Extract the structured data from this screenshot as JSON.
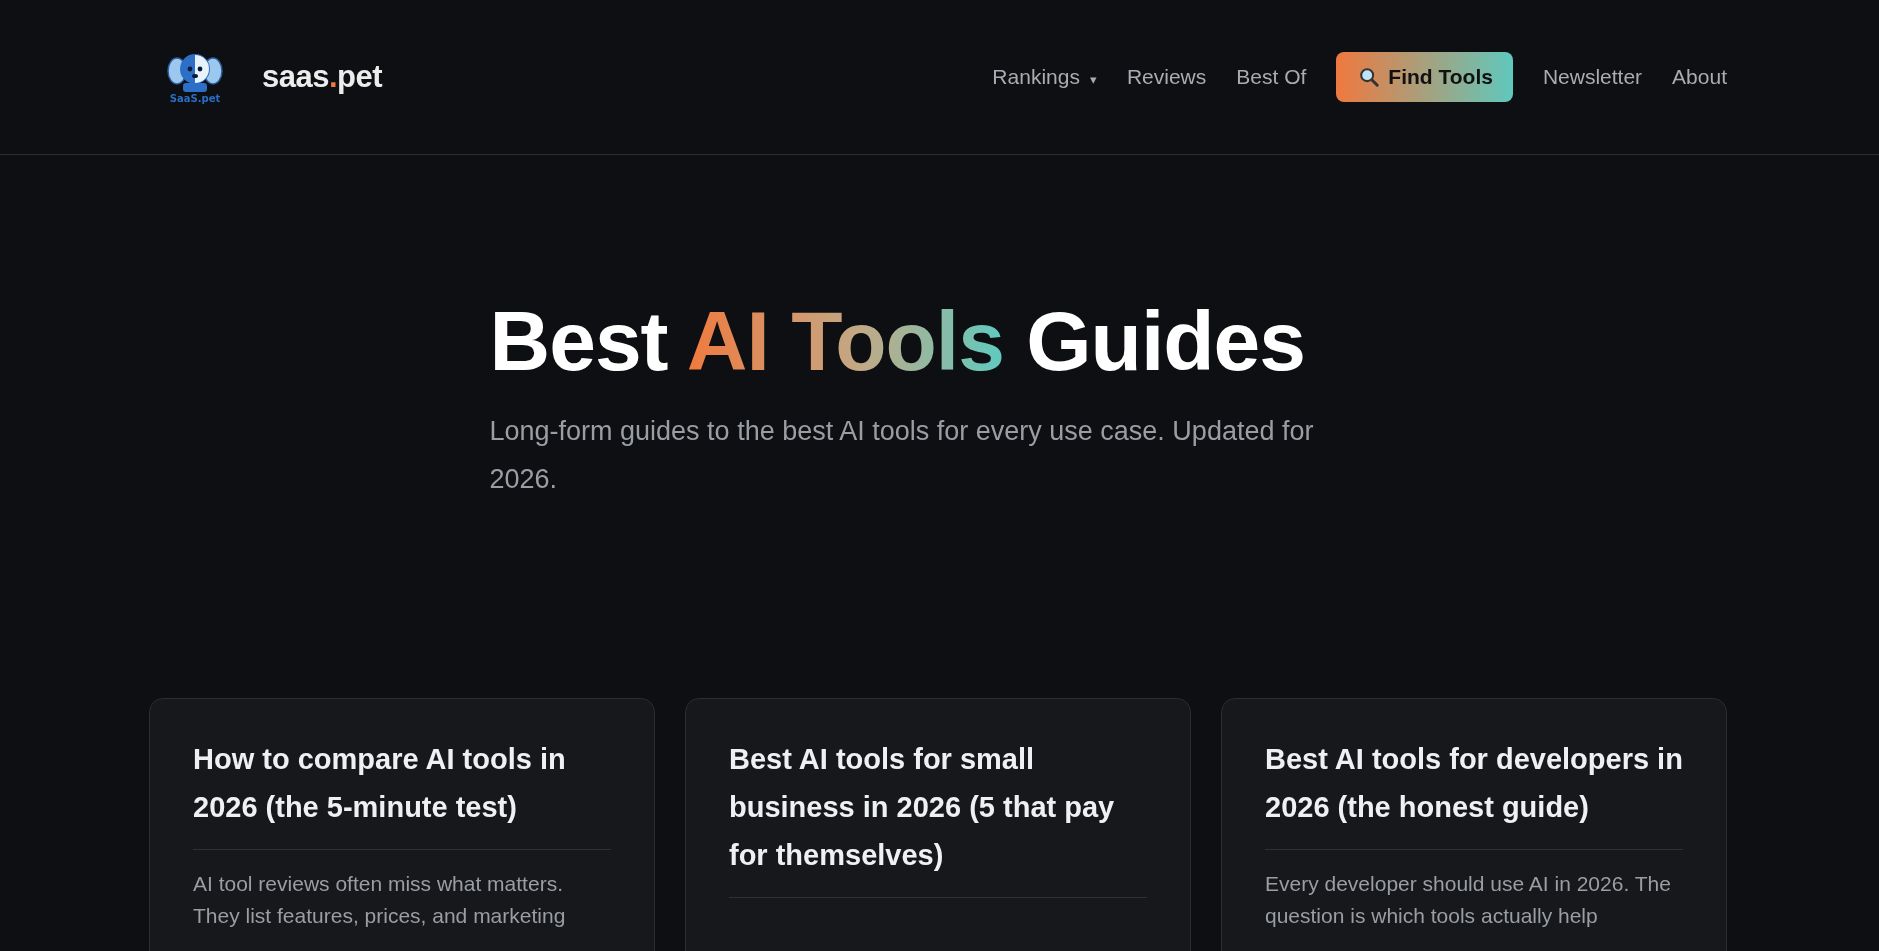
{
  "header": {
    "logo_caption": "SaaS.pet",
    "brand_parts": [
      {
        "text": "saas",
        "accent": false
      },
      {
        "text": ".",
        "accent": true
      },
      {
        "text": "pet",
        "accent": false
      }
    ],
    "nav": [
      {
        "kind": "link",
        "label": "Rankings",
        "caret": "▾"
      },
      {
        "kind": "link",
        "label": "Reviews"
      },
      {
        "kind": "link",
        "label": "Best Of"
      },
      {
        "kind": "cta",
        "label": "Find Tools"
      },
      {
        "kind": "link",
        "label": "Newsletter"
      },
      {
        "kind": "link",
        "label": "About"
      }
    ]
  },
  "hero": {
    "title_parts": [
      {
        "text": "Best",
        "highlight": false
      },
      {
        "text": "AI Tools",
        "highlight": true
      },
      {
        "text": "Guides",
        "highlight": false
      }
    ],
    "subtitle": "Long-form guides to the best AI tools for every use case. Updated for 2026."
  },
  "cards": [
    {
      "title": "How to compare AI tools in 2026 (the 5-minute test)",
      "excerpt": "AI tool reviews often miss what matters. They list features, prices, and marketing"
    },
    {
      "title": "Best AI tools for small business in 2026 (5 that pay for themselves)"
    },
    {
      "title": "Best AI tools for developers in 2026 (the honest guide)",
      "excerpt": "Every developer should use AI in 2026. The question is which tools actually help"
    }
  ]
}
